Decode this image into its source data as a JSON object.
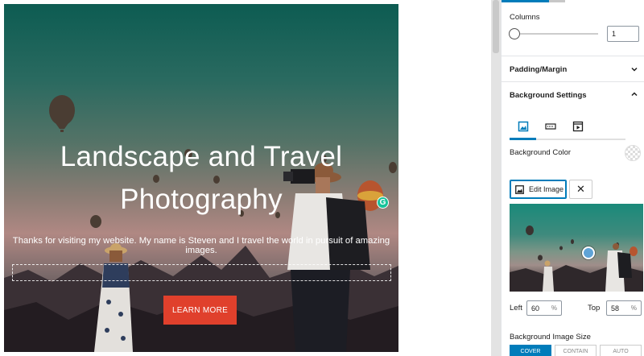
{
  "hero": {
    "title_line1": "Landscape and Travel",
    "title_line2": "Photography",
    "subtitle": "Thanks for visiting my website. My name is Steven and I travel the world in pursuit of amazing images.",
    "button_label": "LEARN MORE",
    "grammarly_badge": "G"
  },
  "sidebar": {
    "columns": {
      "label": "Columns",
      "value": "1",
      "slider_value": 1
    },
    "padding_margin": {
      "title": "Padding/Margin",
      "expanded": false
    },
    "background_settings": {
      "title": "Background Settings",
      "expanded": true,
      "tabs": [
        {
          "name": "image-tab",
          "active": true
        },
        {
          "name": "gradient-tab",
          "active": false
        },
        {
          "name": "video-tab",
          "active": false
        }
      ],
      "color_label": "Background Color",
      "edit_image_label": "Edit Image",
      "remove_label": "✕",
      "focal_point": {
        "left_label": "Left",
        "left_value": "60",
        "left_unit": "%",
        "top_label": "Top",
        "top_value": "58",
        "top_unit": "%"
      },
      "size_label": "Background Image Size",
      "size_options": [
        "COVER",
        "CONTAIN",
        "AUTO"
      ],
      "size_selected": "COVER"
    }
  },
  "colors": {
    "accent": "#007cba",
    "cta": "#e0402c",
    "grammarly": "#15c39a"
  }
}
